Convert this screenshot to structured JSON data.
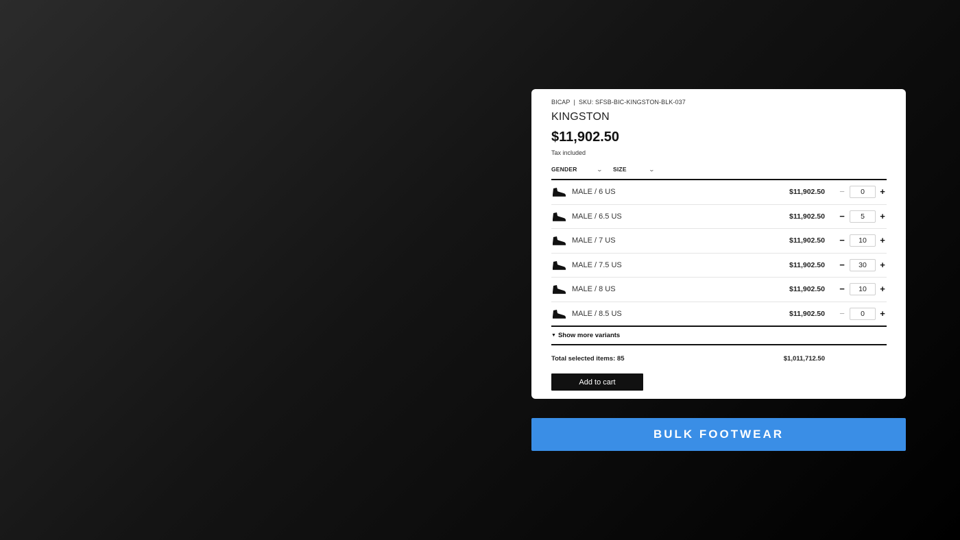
{
  "product": {
    "vendor": "BICAP",
    "separator": "|",
    "sku_label": "SKU: SFSB-BIC-KINGSTON-BLK-037",
    "title": "KINGSTON",
    "price": "$11,902.50",
    "tax_note": "Tax included"
  },
  "filters": {
    "gender_label": "GENDER",
    "size_label": "SIZE"
  },
  "variants": [
    {
      "label": "MALE / 6 US",
      "price": "$11,902.50",
      "qty": "0",
      "minus_enabled": false
    },
    {
      "label": "MALE / 6.5 US",
      "price": "$11,902.50",
      "qty": "5",
      "minus_enabled": true
    },
    {
      "label": "MALE / 7 US",
      "price": "$11,902.50",
      "qty": "10",
      "minus_enabled": true
    },
    {
      "label": "MALE / 7.5 US",
      "price": "$11,902.50",
      "qty": "30",
      "minus_enabled": true
    },
    {
      "label": "MALE / 8 US",
      "price": "$11,902.50",
      "qty": "10",
      "minus_enabled": true
    },
    {
      "label": "MALE / 8.5 US",
      "price": "$11,902.50",
      "qty": "0",
      "minus_enabled": false
    }
  ],
  "controls": {
    "minus_symbol": "−",
    "plus_symbol": "+",
    "chevron_icon": "chevron-down-icon",
    "caret_icon": "caret-down-icon",
    "variant_icon": "boot-icon"
  },
  "show_more_label": "Show more variants",
  "totals": {
    "label": "Total selected items: 85",
    "price": "$1,011,712.50"
  },
  "add_to_cart_label": "Add to cart",
  "banner": {
    "text": "BULK FOOTWEAR",
    "color": "#3a8ee6"
  }
}
